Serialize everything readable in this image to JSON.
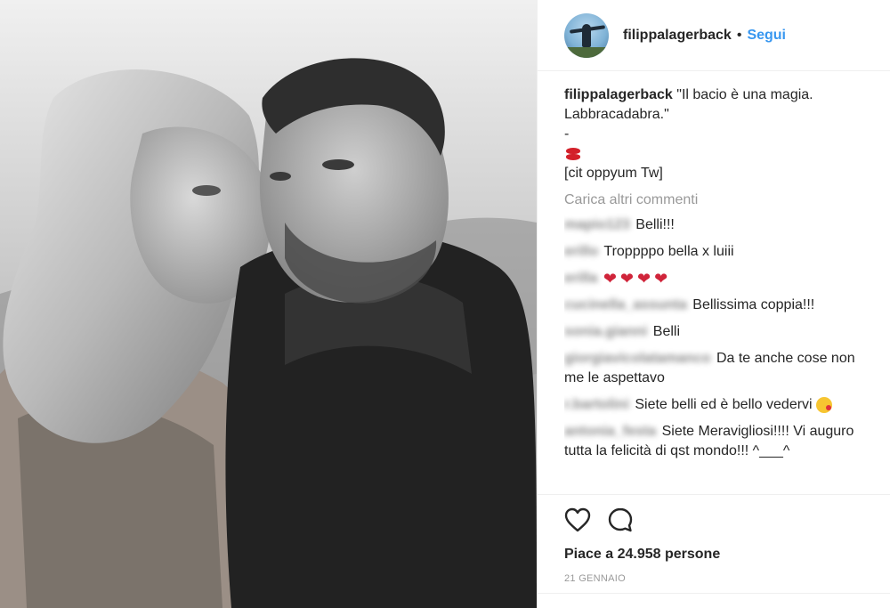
{
  "header": {
    "username": "filippalagerback",
    "separator": "•",
    "follow_label": "Segui"
  },
  "caption": {
    "username": "filippalagerback",
    "line1": "\"Il bacio è una magia.",
    "line2": "Labbracadabra.\"",
    "line3": "-",
    "emoji": "kiss-mark",
    "line5": "[cit oppyum Tw]"
  },
  "load_more_label": "Carica altri commenti",
  "comments": [
    {
      "user": "mapio123",
      "text": "Belli!!!"
    },
    {
      "user": "erillo",
      "text": "Troppppo bella x luiii"
    },
    {
      "user": "erilla",
      "text": "",
      "hearts": [
        "heart-emoji",
        "heart-emoji",
        "heart-emoji",
        "heart-emoji"
      ]
    },
    {
      "user": "cucinella_assunta",
      "text": "Bellissima coppia!!!"
    },
    {
      "user": "sonia.gianni",
      "text": "Belli"
    },
    {
      "user": "giorgiavicolatamanco",
      "text": "Da te anche cose non me le aspettavo"
    },
    {
      "user": "r.bartolini",
      "text": "Siete belli ed è bello vedervi",
      "emoji": "kissing-face"
    },
    {
      "user": "antonia_festa",
      "text": "Siete Meravigliosi!!!! Vi auguro tutta la felicità di qst mondo!!! ^___^"
    }
  ],
  "actions": {
    "like_icon": "heart-outline-icon",
    "comment_icon": "comment-bubble-icon"
  },
  "likes_text": "Piace a 24.958 persone",
  "date_text": "21 GENNAIO",
  "colors": {
    "link": "#3897f0",
    "text": "#262626",
    "muted": "#999999",
    "border": "#efefef"
  }
}
